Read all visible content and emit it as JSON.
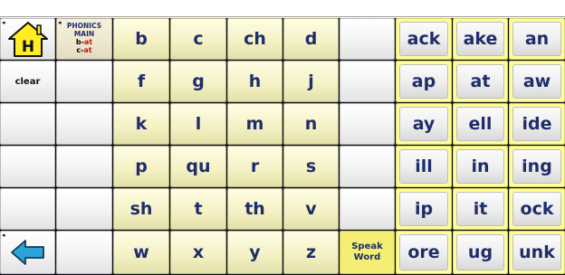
{
  "home": {
    "letter": "H",
    "marker": "◂"
  },
  "phonics": {
    "line1": "PHONICS",
    "line2": "MAIN",
    "ex1_onset": "b-",
    "ex1_rime": "at",
    "ex2_onset": "c-",
    "ex2_rime": "at"
  },
  "clear_label": "clear",
  "back": {
    "marker": "◂"
  },
  "onsets": [
    [
      "b",
      "c",
      "ch",
      "d"
    ],
    [
      "f",
      "g",
      "h",
      "j"
    ],
    [
      "k",
      "l",
      "m",
      "n"
    ],
    [
      "p",
      "qu",
      "r",
      "s"
    ],
    [
      "sh",
      "t",
      "th",
      "v"
    ],
    [
      "w",
      "x",
      "y",
      "z"
    ]
  ],
  "speak_word": {
    "line1": "Speak",
    "line2": "Word"
  },
  "rimes": [
    [
      "ack",
      "ake",
      "an"
    ],
    [
      "ap",
      "at",
      "aw"
    ],
    [
      "ay",
      "ell",
      "ide"
    ],
    [
      "ill",
      "in",
      "ing"
    ],
    [
      "ip",
      "it",
      "ock"
    ],
    [
      "ore",
      "ug",
      "unk"
    ]
  ],
  "colors": {
    "text": "#1f2d6b",
    "home_yellow": "#ffee22",
    "back_arrow": "#2aa3d8",
    "rime_highlight": "#fdfd9a",
    "speak_word_bg": "#f4ee74"
  }
}
